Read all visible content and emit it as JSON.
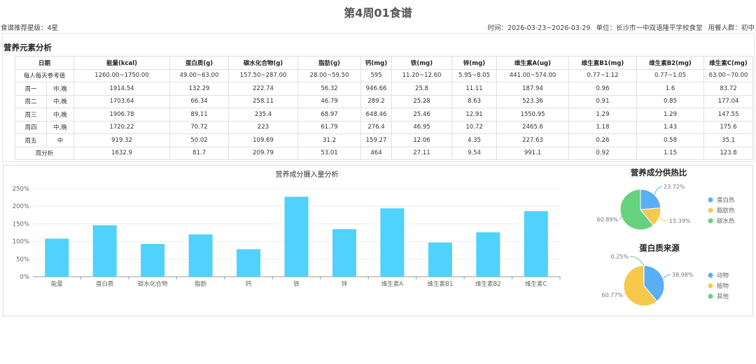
{
  "title": "第4周01食谱",
  "rating": "食谱推荐星级：4星",
  "meta": {
    "time": "时间：2026-03-23~2026-03-29",
    "unit": "单位：长沙市一中双语隆平学校食堂",
    "group": "用餐人群：初中"
  },
  "section_title": "营养元素分析",
  "table": {
    "headers": [
      "日期",
      "能量(kcal)",
      "蛋白质(g)",
      "碳水化合物(g)",
      "脂肪(g)",
      "钙(mg)",
      "铁(mg)",
      "锌(mg)",
      "维生素A(ug)",
      "维生素B1(mg)",
      "维生素B2(mg)",
      "维生素C(mg)"
    ],
    "reference": [
      "每人每天参考值",
      "1260.00~1750.00",
      "49.00~63.00",
      "157.50~287.00",
      "28.00~59.50",
      "595",
      "11.20~12.60",
      "5.95~8.05",
      "441.00~574.00",
      "0.77~1.12",
      "0.77~1.05",
      "63.00~70.00"
    ],
    "rows": [
      [
        "周一",
        "中,晚",
        "1914.54",
        "132.29",
        "222.74",
        "56.32",
        "946.66",
        "25.8",
        "11.11",
        "187.94",
        "0.96",
        "1.6",
        "83.72"
      ],
      [
        "周二",
        "中,晚",
        "1703.64",
        "66.34",
        "258.11",
        "46.79",
        "289.2",
        "25.28",
        "8.63",
        "523.36",
        "0.91",
        "0.85",
        "177.04"
      ],
      [
        "周三",
        "中,晚",
        "1906.78",
        "89.11",
        "235.4",
        "68.97",
        "648.46",
        "25.46",
        "12.91",
        "1550.95",
        "1.29",
        "1.29",
        "147.55"
      ],
      [
        "周四",
        "中,晚",
        "1720.22",
        "70.72",
        "223",
        "61.79",
        "276.4",
        "46.95",
        "10.72",
        "2465.6",
        "1.18",
        "1.43",
        "175.6"
      ],
      [
        "周五",
        "中",
        "919.32",
        "50.02",
        "109.69",
        "31.2",
        "159.27",
        "12.06",
        "4.35",
        "227.63",
        "0.26",
        "0.58",
        "35.1"
      ]
    ],
    "summary": [
      "周分析",
      "1632.9",
      "81.7",
      "209.79",
      "53.01",
      "464",
      "27.11",
      "9.54",
      "991.1",
      "0.92",
      "1.15",
      "123.8"
    ]
  },
  "chart_data": [
    {
      "type": "bar",
      "title": "营养成分摄入量分析",
      "categories": [
        "能量",
        "蛋白质",
        "碳水化合物",
        "脂肪",
        "钙",
        "铁",
        "锌",
        "维生素A",
        "维生素B1",
        "维生素B2",
        "维生素C"
      ],
      "values": [
        108,
        146,
        93,
        120,
        78,
        227,
        135,
        194,
        97,
        126,
        186
      ],
      "yticks": [
        "0%",
        "50%",
        "100%",
        "150%",
        "200%",
        "250%"
      ],
      "ylim": [
        0,
        250
      ],
      "color": "#4fd2fb"
    },
    {
      "type": "pie",
      "title": "营养成分供热比",
      "slices": [
        {
          "name": "蛋白热",
          "value": 23.72,
          "label": "23.72%",
          "color": "#5aaef5"
        },
        {
          "name": "脂肪热",
          "value": 15.39,
          "label": "15.39%",
          "color": "#f6c94d"
        },
        {
          "name": "碳水热",
          "value": 60.89,
          "label": "60.89%",
          "color": "#66d17e"
        }
      ]
    },
    {
      "type": "pie",
      "title": "蛋白质来源",
      "slices": [
        {
          "name": "动物",
          "value": 38.98,
          "label": "38.98%",
          "color": "#5aaef5"
        },
        {
          "name": "植物",
          "value": 60.77,
          "label": "60.77%",
          "color": "#f6c94d"
        },
        {
          "name": "其他",
          "value": 0.25,
          "label": "0.25%",
          "color": "#66d17e"
        }
      ]
    }
  ]
}
